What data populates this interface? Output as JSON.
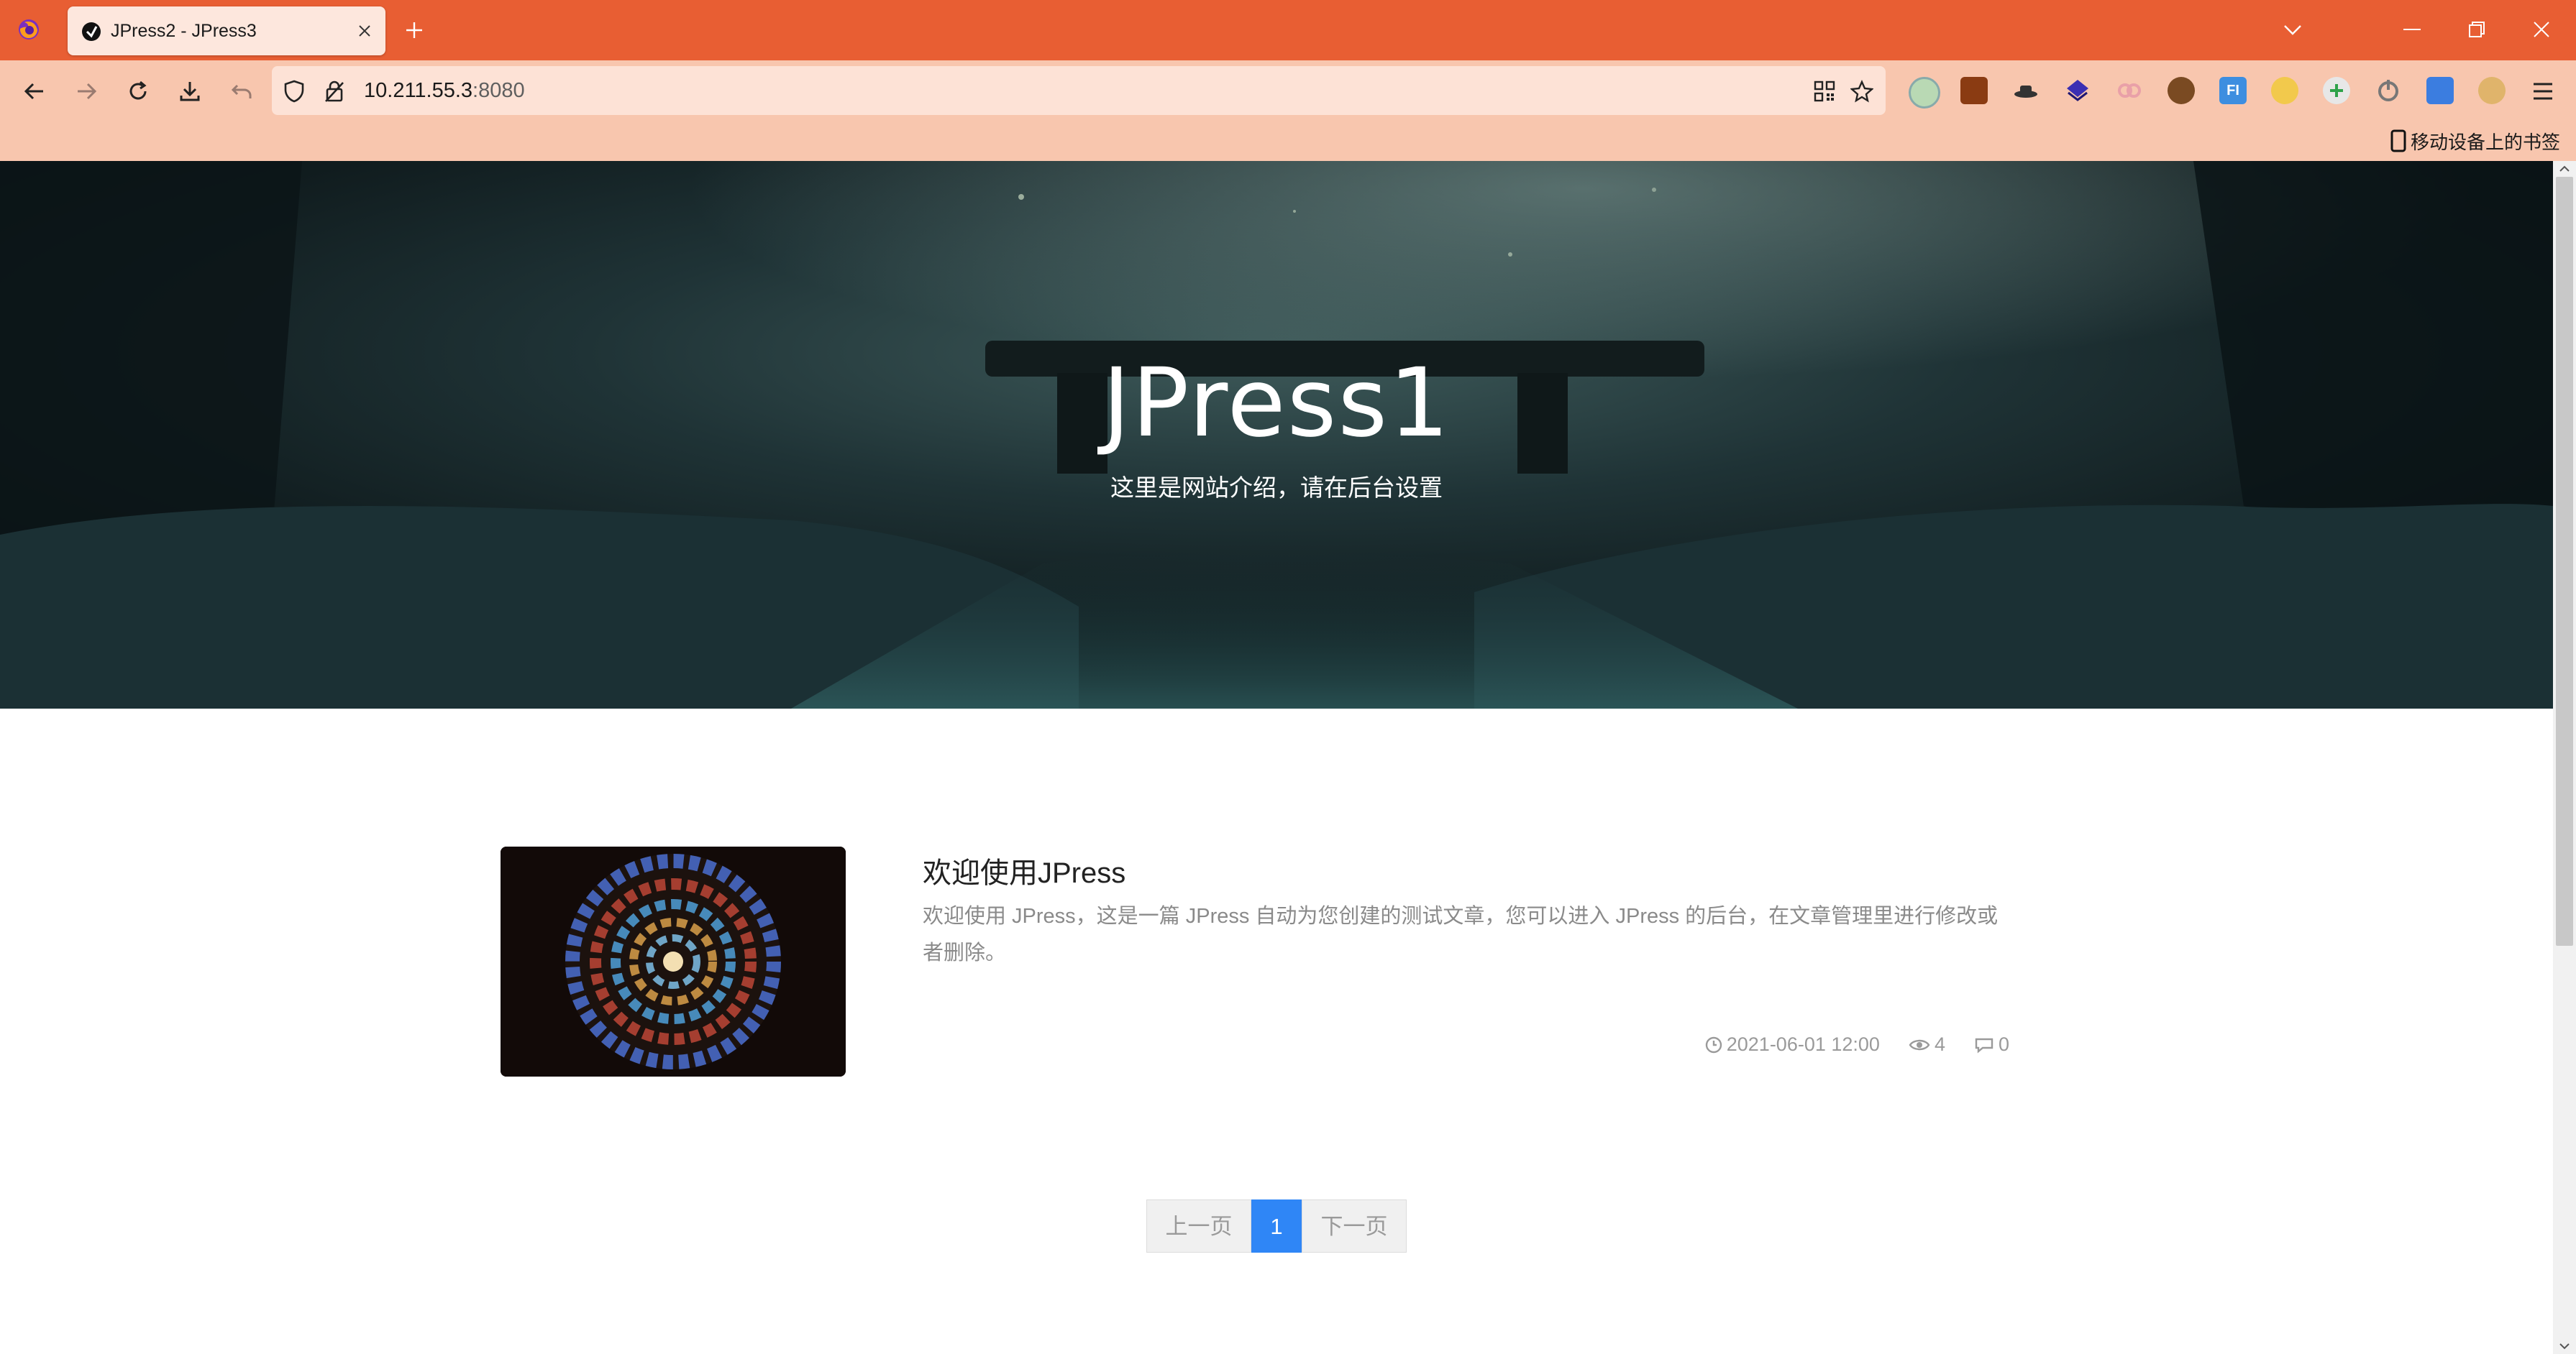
{
  "browser": {
    "tab_title": "JPress2 - JPress3",
    "url_host": "10.211.55.3",
    "url_port": ":8080",
    "mobile_bookmarks": "移动设备上的书签",
    "accent_color": "#e85e33"
  },
  "hero": {
    "title": "JPress1",
    "subtitle": "这里是网站介绍，请在后台设置"
  },
  "article": {
    "title": "欢迎使用JPress",
    "summary": "欢迎使用 JPress，这是一篇 JPress 自动为您创建的测试文章，您可以进入 JPress 的后台，在文章管理里进行修改或者删除。",
    "date": "2021-06-01 12:00",
    "views": "4",
    "comments": "0"
  },
  "pagination": {
    "prev": "上一页",
    "current": "1",
    "next": "下一页",
    "active_color": "#2f86f6"
  }
}
